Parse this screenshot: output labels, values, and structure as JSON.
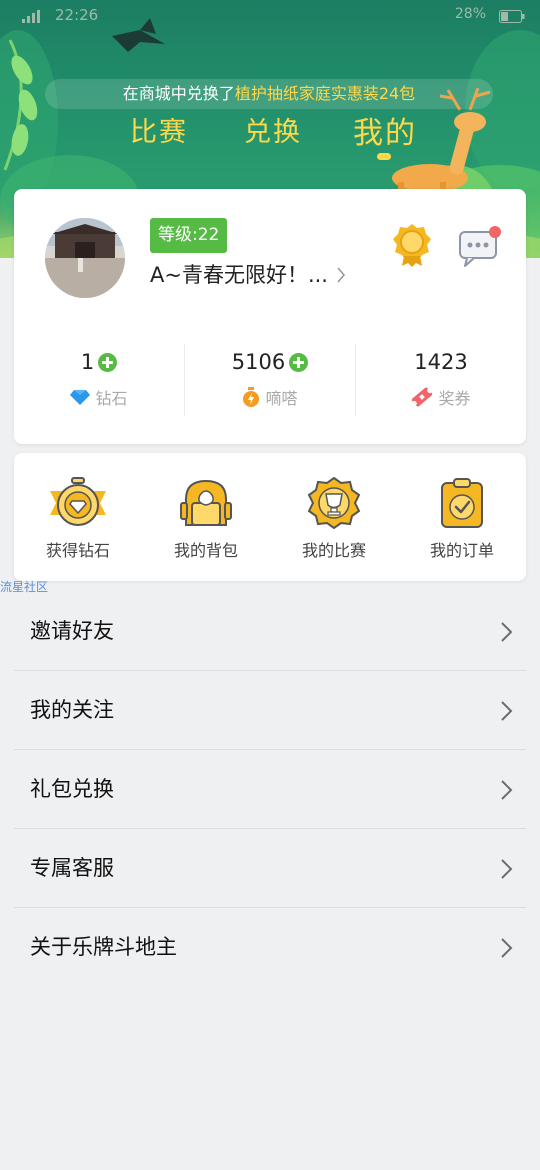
{
  "status_bar": {
    "time": "22:26",
    "battery": "28%"
  },
  "ticker": {
    "prefix": "在商城中兑换了",
    "highlight": "植护抽纸家庭实惠装24包"
  },
  "tabs": [
    {
      "label": "比赛"
    },
    {
      "label": "兑换"
    },
    {
      "label": "我的",
      "active": true
    }
  ],
  "profile": {
    "level": "等级:22",
    "username": "A~青春无限好！...",
    "icons": {
      "medal": "medal-icon",
      "message": "message-icon"
    }
  },
  "stats": [
    {
      "value": "1",
      "label": "钻石",
      "icon": "diamond-icon",
      "has_add": true
    },
    {
      "value": "5106",
      "label": "嘀嗒",
      "icon": "stopwatch-icon",
      "has_add": true
    },
    {
      "value": "1423",
      "label": "奖券",
      "icon": "ticket-icon",
      "has_add": false
    }
  ],
  "actions": [
    {
      "label": "获得钻石",
      "icon": "diamond-medal-icon"
    },
    {
      "label": "我的背包",
      "icon": "backpack-icon"
    },
    {
      "label": "我的比赛",
      "icon": "trophy-icon"
    },
    {
      "label": "我的订单",
      "icon": "clipboard-check-icon"
    }
  ],
  "tag": "流星社区",
  "menu": [
    {
      "label": "邀请好友"
    },
    {
      "label": "我的关注"
    },
    {
      "label": "礼包兑换"
    },
    {
      "label": "专属客服"
    },
    {
      "label": "关于乐牌斗地主"
    }
  ],
  "colors": {
    "accent_green": "#56bb45",
    "tab_yellow": "#ffd84a",
    "icon_gold": "#f5b722",
    "banner_green": "#23926c"
  }
}
